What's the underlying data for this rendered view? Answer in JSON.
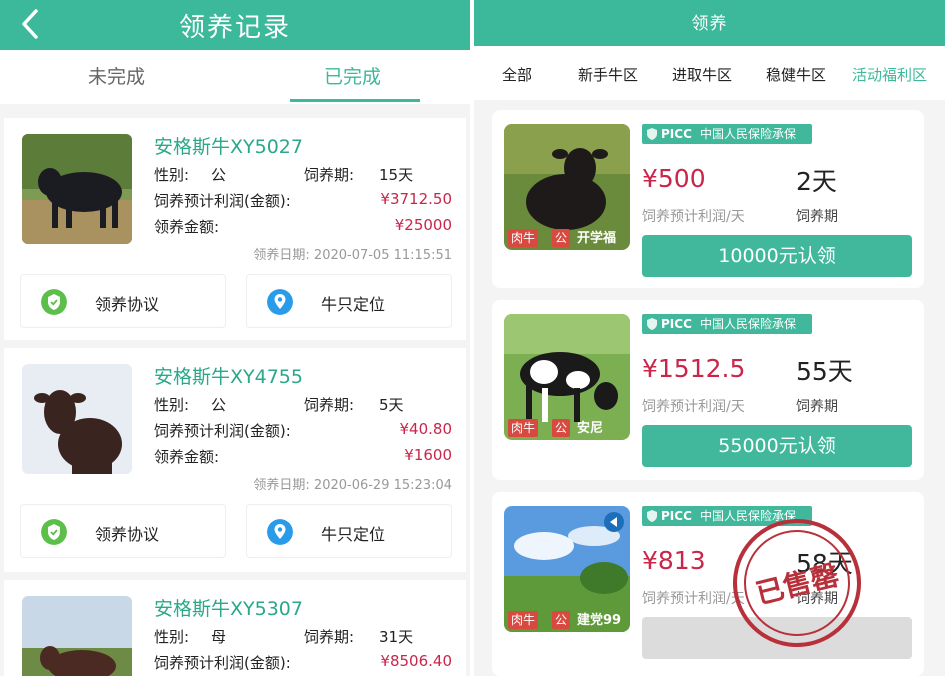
{
  "left": {
    "title": "领养记录",
    "tabs": [
      "未完成",
      "已完成"
    ],
    "records": [
      {
        "name": "安格斯牛XY5027",
        "sex_label": "性别:",
        "sex": "公",
        "period_label": "饲养期:",
        "period": "15天",
        "profit_label": "饲养预计利润(金额):",
        "profit": "¥3712.50",
        "amount_label": "领养金额:",
        "amount": "¥25000",
        "date": "领养日期: 2020-07-05 11:15:51",
        "agreement": "领养协议",
        "locate": "牛只定位"
      },
      {
        "name": "安格斯牛XY4755",
        "sex_label": "性别:",
        "sex": "公",
        "period_label": "饲养期:",
        "period": "5天",
        "profit_label": "饲养预计利润(金额):",
        "profit": "¥40.80",
        "amount_label": "领养金额:",
        "amount": "¥1600",
        "date": "领养日期: 2020-06-29 15:23:04",
        "agreement": "领养协议",
        "locate": "牛只定位"
      },
      {
        "name": "安格斯牛XY5307",
        "sex_label": "性别:",
        "sex": "母",
        "period_label": "饲养期:",
        "period": "31天",
        "profit_label": "饲养预计利润(金额):",
        "profit": "¥8506.40"
      }
    ]
  },
  "right": {
    "title": "领养",
    "categories": [
      "全部",
      "新手牛区",
      "进取牛区",
      "稳健牛区",
      "活动福利区"
    ],
    "insurance_brand": "PICC",
    "insurance_text": "中国人民保险承保",
    "products": [
      {
        "tag_type": "肉牛",
        "tag_sex": "公",
        "tag_name": "开学福",
        "price": "¥500",
        "days": "2天",
        "price_label": "饲养预计利润/天",
        "days_label": "饲养期",
        "button": "10000元认领"
      },
      {
        "tag_type": "肉牛",
        "tag_sex": "公",
        "tag_name": "安尼",
        "price": "¥1512.5",
        "days": "55天",
        "price_label": "饲养预计利润/天",
        "days_label": "饲养期",
        "button": "55000元认领"
      },
      {
        "tag_type": "肉牛",
        "tag_sex": "公",
        "tag_name": "建党99",
        "price": "¥813",
        "days": "58天",
        "price_label": "饲养预计利润/天",
        "days_label": "饲养期",
        "button": "",
        "stamp": "已售罄"
      }
    ]
  },
  "colors": {
    "primary": "#3cb89a",
    "price_red": "#c8264a",
    "tag_red": "#d84a3f"
  }
}
